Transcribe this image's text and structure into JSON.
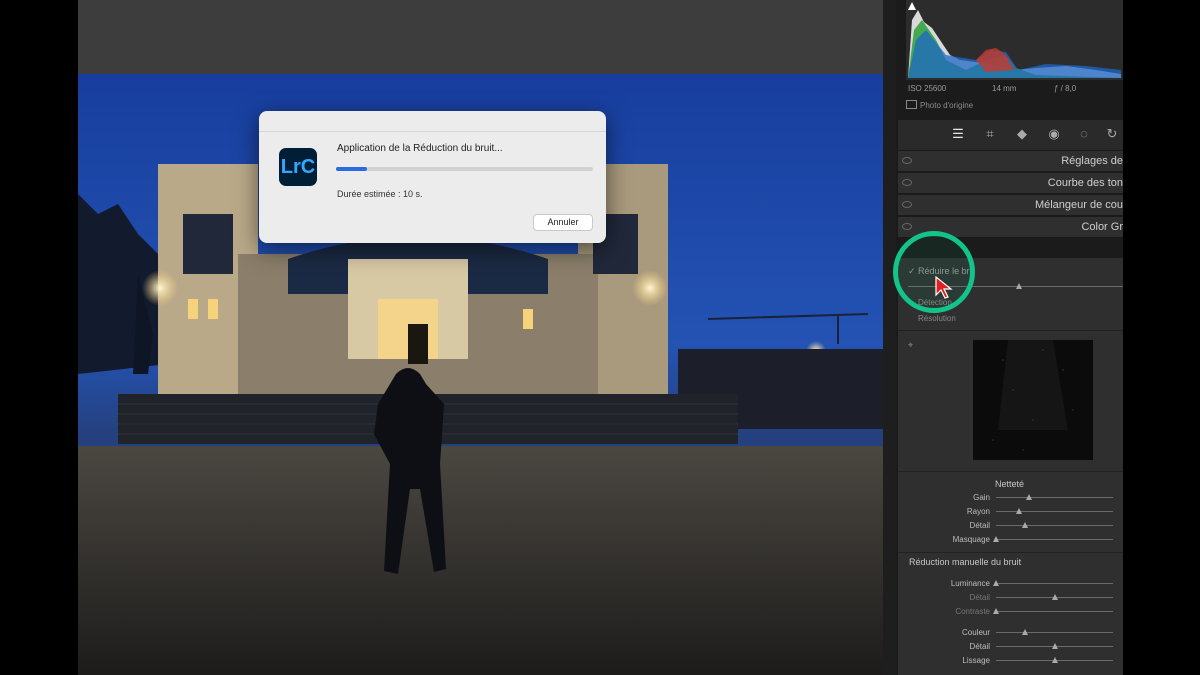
{
  "dialog": {
    "title": "Application de la Réduction du bruit...",
    "progress": 0.12,
    "estimated": "Durée estimée : 10 s.",
    "cancel": "Annuler",
    "app_logo": "LrC"
  },
  "histogram": {
    "iso": "ISO 25600",
    "focal": "14 mm",
    "aperture": "ƒ / 8,0",
    "original_photo": "Photo d'origine"
  },
  "tools": [
    {
      "icon": "sliders-icon",
      "active": true
    },
    {
      "icon": "crop-icon",
      "active": false
    },
    {
      "icon": "eraser-icon",
      "active": false
    },
    {
      "icon": "red-eye-icon",
      "active": false
    },
    {
      "icon": "masking-icon",
      "active": false
    },
    {
      "icon": "sync-icon",
      "active": false
    }
  ],
  "sections": [
    {
      "label": "Réglages de"
    },
    {
      "label": "Courbe des ton"
    },
    {
      "label": "Mélangeur de cou"
    },
    {
      "label": "Color Gr"
    }
  ],
  "detail": {
    "denoise_check": "Réduire le bru",
    "detection": "Détection",
    "resolution": "Résolution",
    "sharpening_header": "Netteté",
    "sharpening": [
      {
        "label": "Gain",
        "value": 0.28
      },
      {
        "label": "Rayon",
        "value": 0.2
      },
      {
        "label": "Détail",
        "value": 0.25
      },
      {
        "label": "Masquage",
        "value": 0.0
      }
    ],
    "manual_nr_header": "Réduction manuelle du bruit",
    "luminance": [
      {
        "label": "Luminance",
        "value": 0.0,
        "dim": false
      },
      {
        "label": "Détail",
        "value": 0.5,
        "dim": true
      },
      {
        "label": "Contraste",
        "value": 0.0,
        "dim": true
      }
    ],
    "color": [
      {
        "label": "Couleur",
        "value": 0.25,
        "dim": false
      },
      {
        "label": "Détail",
        "value": 0.5,
        "dim": false
      },
      {
        "label": "Lissage",
        "value": 0.5,
        "dim": false
      }
    ]
  },
  "colors": {
    "accent_ring": "#12c38a",
    "progress": "#2a6be0",
    "sky": "#1b44a8"
  }
}
